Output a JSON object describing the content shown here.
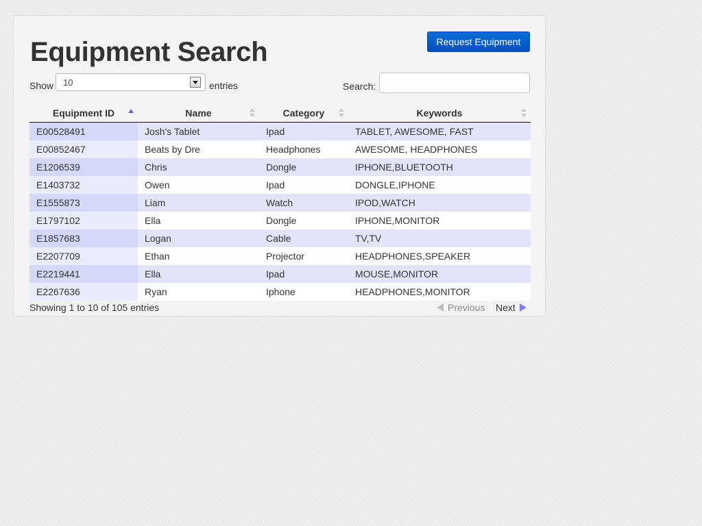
{
  "page": {
    "title": "Equipment Search",
    "request_button_label": "Request Equipment"
  },
  "controls": {
    "show_label": "Show",
    "page_length_value": "10",
    "entries_label": "entries",
    "search_label": "Search:",
    "search_value": ""
  },
  "table": {
    "columns": [
      "Equipment ID",
      "Name",
      "Category",
      "Keywords"
    ],
    "sorted_column": "Equipment ID",
    "sort_direction": "ascending",
    "rows": [
      [
        "E00528491",
        "Josh's Tablet",
        "Ipad",
        "TABLET, AWESOME, FAST"
      ],
      [
        "E00852467",
        "Beats by Dre",
        "Headphones",
        "AWESOME, HEADPHONES"
      ],
      [
        "E1206539",
        "Chris",
        "Dongle",
        "IPHONE,BLUETOOTH"
      ],
      [
        "E1403732",
        "Owen",
        "Ipad",
        "DONGLE,IPHONE"
      ],
      [
        "E1555873",
        "Liam",
        "Watch",
        "IPOD,WATCH"
      ],
      [
        "E1797102",
        "Ella",
        "Dongle",
        "IPHONE,MONITOR"
      ],
      [
        "E1857683",
        "Logan",
        "Cable",
        "TV,TV"
      ],
      [
        "E2207709",
        "Ethan",
        "Projector",
        "HEADPHONES,SPEAKER"
      ],
      [
        "E2219441",
        "Ella",
        "Ipad",
        "MOUSE,MONITOR"
      ],
      [
        "E2267636",
        "Ryan",
        "Iphone",
        "HEADPHONES,MONITOR"
      ]
    ]
  },
  "footer": {
    "info": "Showing 1 to 10 of 105 entries",
    "previous_label": "Previous",
    "next_label": "Next"
  },
  "icons": {
    "previous": "triangle-left-icon",
    "next": "triangle-right-icon",
    "dropdown": "chevron-down-icon",
    "sort": "sort-arrows-icon"
  },
  "colors": {
    "button": "#0a5fcf",
    "row_odd": "#e3e4fa",
    "row_even": "#ffffff",
    "sort_active": "#6b6bd6"
  }
}
